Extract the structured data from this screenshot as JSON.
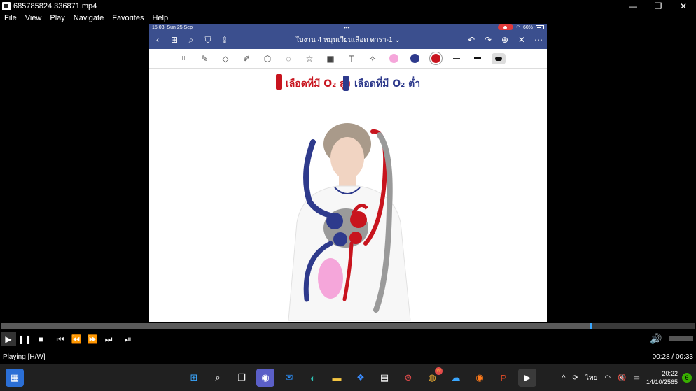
{
  "window": {
    "title": "685785824.336871.mp4",
    "controls": [
      "—",
      "❐",
      "✕"
    ]
  },
  "menu": [
    "File",
    "View",
    "Play",
    "Navigate",
    "Favorites",
    "Help"
  ],
  "ipad": {
    "status_time": "15:03",
    "status_date": "Sun 25 Sep",
    "battery": "60%",
    "doc_title": "ใบงาน 4 หมุนเวียนเลือด ดารา-1 ⌄",
    "legend_high": "เลือดที่มี O₂ สูง",
    "legend_low": "เลือดที่มี O₂ ต่ำ",
    "colors": {
      "nav": "#3b4f8e",
      "pink": "#f5a6da",
      "navy": "#2e3a8c",
      "red": "#c8141e"
    }
  },
  "player": {
    "progress": 0.848,
    "state": "Playing [H/W]",
    "time": "00:28 / 00:33"
  },
  "taskbar": {
    "lang": "ไทย",
    "clock_time": "20:22",
    "clock_date": "14/10/2565",
    "notif_count": "6",
    "w_badge": "W"
  }
}
